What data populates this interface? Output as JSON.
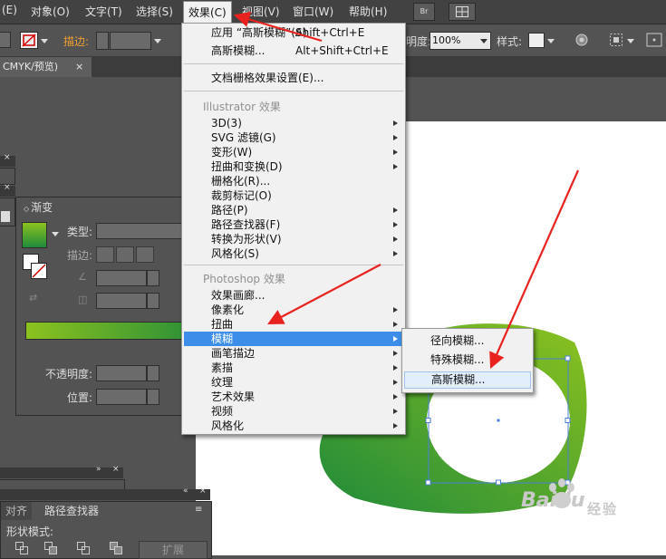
{
  "menubar": {
    "items": [
      "(E)",
      "对象(O)",
      "文字(T)",
      "选择(S)",
      "效果(C)",
      "视图(V)",
      "窗口(W)",
      "帮助(H)"
    ],
    "bridge_label": "Br"
  },
  "control_bar": {
    "stroke_label": "描边:",
    "opacity_partial": "明度:",
    "opacity_value": "100%",
    "style_label": "样式:"
  },
  "document_tab": {
    "title": "CMYK/预览)",
    "close": "×"
  },
  "effect_menu": {
    "apply_last": {
      "label": "应用 “高斯模糊”(A)",
      "shortcut": "Shift+Ctrl+E"
    },
    "last_effect": {
      "label": "高斯模糊...",
      "shortcut": "Alt+Shift+Ctrl+E"
    },
    "raster_settings": "文档栅格效果设置(E)...",
    "illustrator_header": "Illustrator 效果",
    "illustrator_items": [
      "3D(3)",
      "SVG 滤镜(G)",
      "变形(W)",
      "扭曲和变换(D)",
      "栅格化(R)...",
      "裁剪标记(O)",
      "路径(P)",
      "路径查找器(F)",
      "转换为形状(V)",
      "风格化(S)"
    ],
    "photoshop_header": "Photoshop 效果",
    "photoshop_items": [
      "效果画廊...",
      "像素化",
      "扭曲",
      "模糊",
      "画笔描边",
      "素描",
      "纹理",
      "艺术效果",
      "视频",
      "风格化"
    ]
  },
  "blur_submenu": {
    "items": [
      "径向模糊...",
      "特殊模糊...",
      "高斯模糊..."
    ]
  },
  "gradient_panel": {
    "tab": "渐变",
    "type_label": "类型:",
    "stroke_label": "描边:",
    "opacity_label": "不透明度:",
    "position_label": "位置:"
  },
  "pathfinder_panel": {
    "tab_align": "对齐",
    "tab_pathfinder": "路径查找器",
    "shape_modes": "形状模式:",
    "expand": "扩展"
  },
  "watermark": {
    "brand": "Baidu",
    "sub": "经验"
  },
  "colors": {
    "menu_highlight": "#3c8ee8",
    "gradient_start": "#1f8a3a",
    "gradient_end": "#8cc21f",
    "arrow_red": "#e8231f"
  }
}
